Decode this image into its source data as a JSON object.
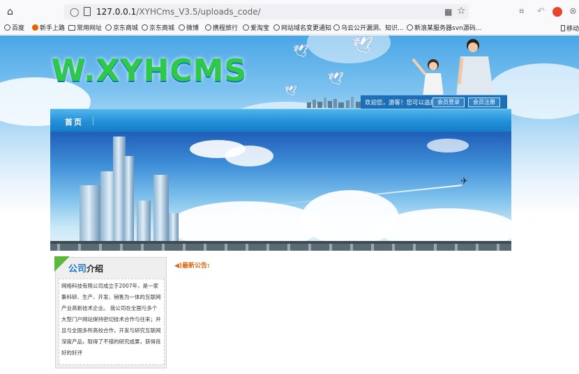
{
  "browser": {
    "url_host": "127.0.0.1",
    "url_path": "/XYHCms_V3.5/uploads_code/",
    "bookmarks": [
      "百度",
      "新手上路",
      "常用网址",
      "京东商城",
      "京东商城",
      "微博",
      "携程旅行",
      "爱淘宝",
      "网站域名变更通知",
      "乌云公开漏洞、知识...",
      "新浪某服务器svn源码..."
    ],
    "mobile_label": "移动"
  },
  "header": {
    "logo_text": "W.XYHCMS",
    "welcome": "欢迎您，游客！您可以选择",
    "login_label": "会员登录",
    "register_label": "会员注册"
  },
  "nav": {
    "items": [
      "首页"
    ]
  },
  "about": {
    "title_highlight": "公司",
    "title_rest": "介绍",
    "body": "网络科技有限公司成立于2007年，是一家集科研、生产、开发、销售为一体的互联网产业高新技术企业。 我公司在全国与多个大型门户网站保持密切技术合作与往来；并且与全国多所高校合作，开发与研究互联网深度产品，取得了不错的研究成果，获得良好的好评"
  },
  "notice": {
    "label": "最新公告:"
  },
  "colors": {
    "nav_blue": "#2290d8",
    "login_bar": "#1c6fb6",
    "notice_orange": "#e06a13",
    "about_tab_green": "#5cb83a"
  }
}
